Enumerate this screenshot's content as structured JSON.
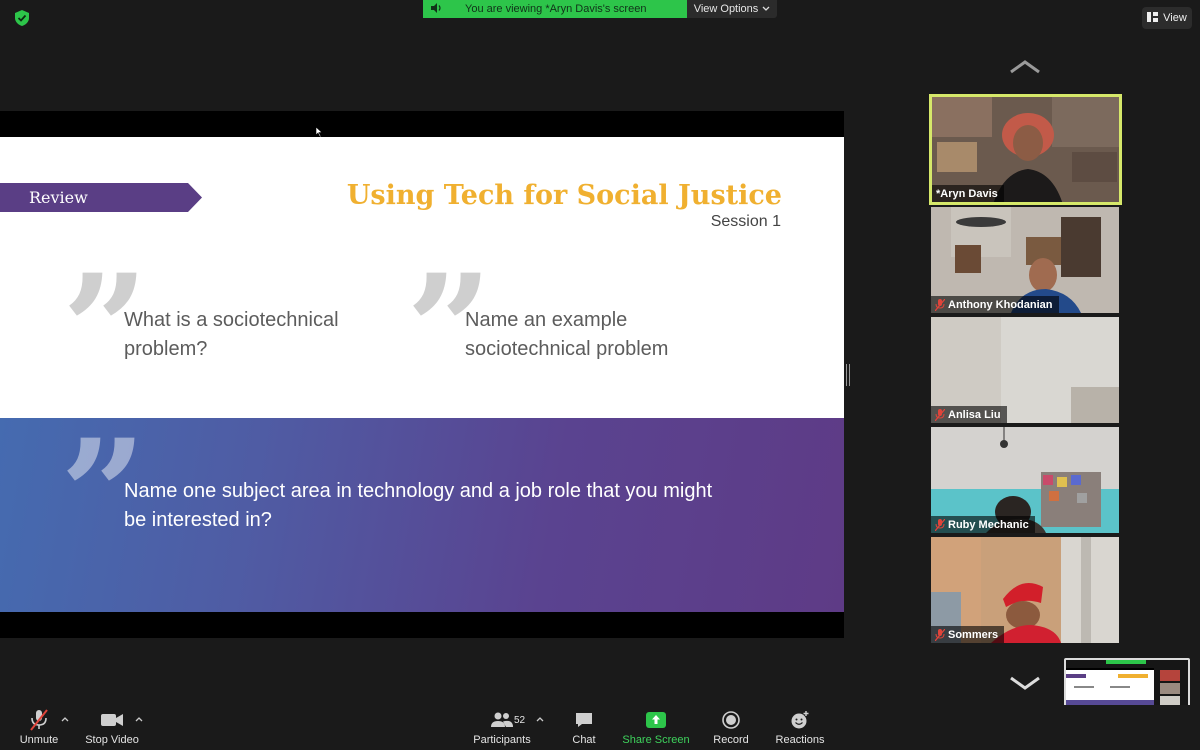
{
  "banner": {
    "viewing_text": "You are viewing *Aryn Davis's screen",
    "options_label": "View Options"
  },
  "view_button": {
    "label": "View"
  },
  "slide": {
    "tag": "Review",
    "title": "Using Tech for Social Justice",
    "subtitle": "Session 1",
    "question1": "What is a sociotechnical problem?",
    "question2": "Name an example sociotechnical problem",
    "question3": "Name one subject area in technology and a job role that you might be interested in?"
  },
  "participants_gallery": [
    {
      "name": "*Aryn Davis",
      "muted": false,
      "active": true
    },
    {
      "name": "Anthony Khodanian",
      "muted": true,
      "active": false
    },
    {
      "name": "Anlisa Liu",
      "muted": true,
      "active": false
    },
    {
      "name": "Ruby Mechanic",
      "muted": true,
      "active": false
    },
    {
      "name": "Sommers",
      "muted": true,
      "active": false
    }
  ],
  "toolbar": {
    "unmute": "Unmute",
    "stop_video": "Stop Video",
    "participants": "Participants",
    "participants_count": "52",
    "chat": "Chat",
    "share_screen": "Share Screen",
    "record": "Record",
    "reactions": "Reactions"
  },
  "colors": {
    "accent_green": "#2dc54a",
    "title_gold": "#f0b030",
    "purple": "#5a3e85",
    "active_border": "#d6e86a"
  },
  "icons": [
    "shield-icon",
    "speaker-icon",
    "chevron-down-icon",
    "grid-view-icon",
    "chevron-up-icon",
    "mic-muted-icon",
    "video-icon",
    "participants-icon",
    "chat-icon",
    "share-screen-icon",
    "record-icon",
    "reactions-icon"
  ]
}
